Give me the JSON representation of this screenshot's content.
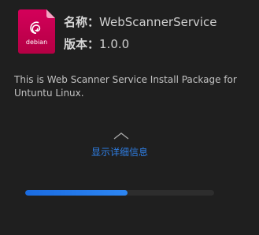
{
  "package": {
    "icon_name": "debian-package-icon",
    "icon_label": "debian",
    "icon_color": "#c8004e",
    "name_label": "名称：",
    "name_value": "WebScannerService",
    "version_label": "版本：",
    "version_value": "1.0.0",
    "description": "This is Web Scanner Service Install Package for Untuntu Linux."
  },
  "details": {
    "toggle_icon": "chevron-up-icon",
    "label": "显示详细信息",
    "accent_color": "#2f7fe6"
  },
  "progress": {
    "fraction": 0.54
  }
}
